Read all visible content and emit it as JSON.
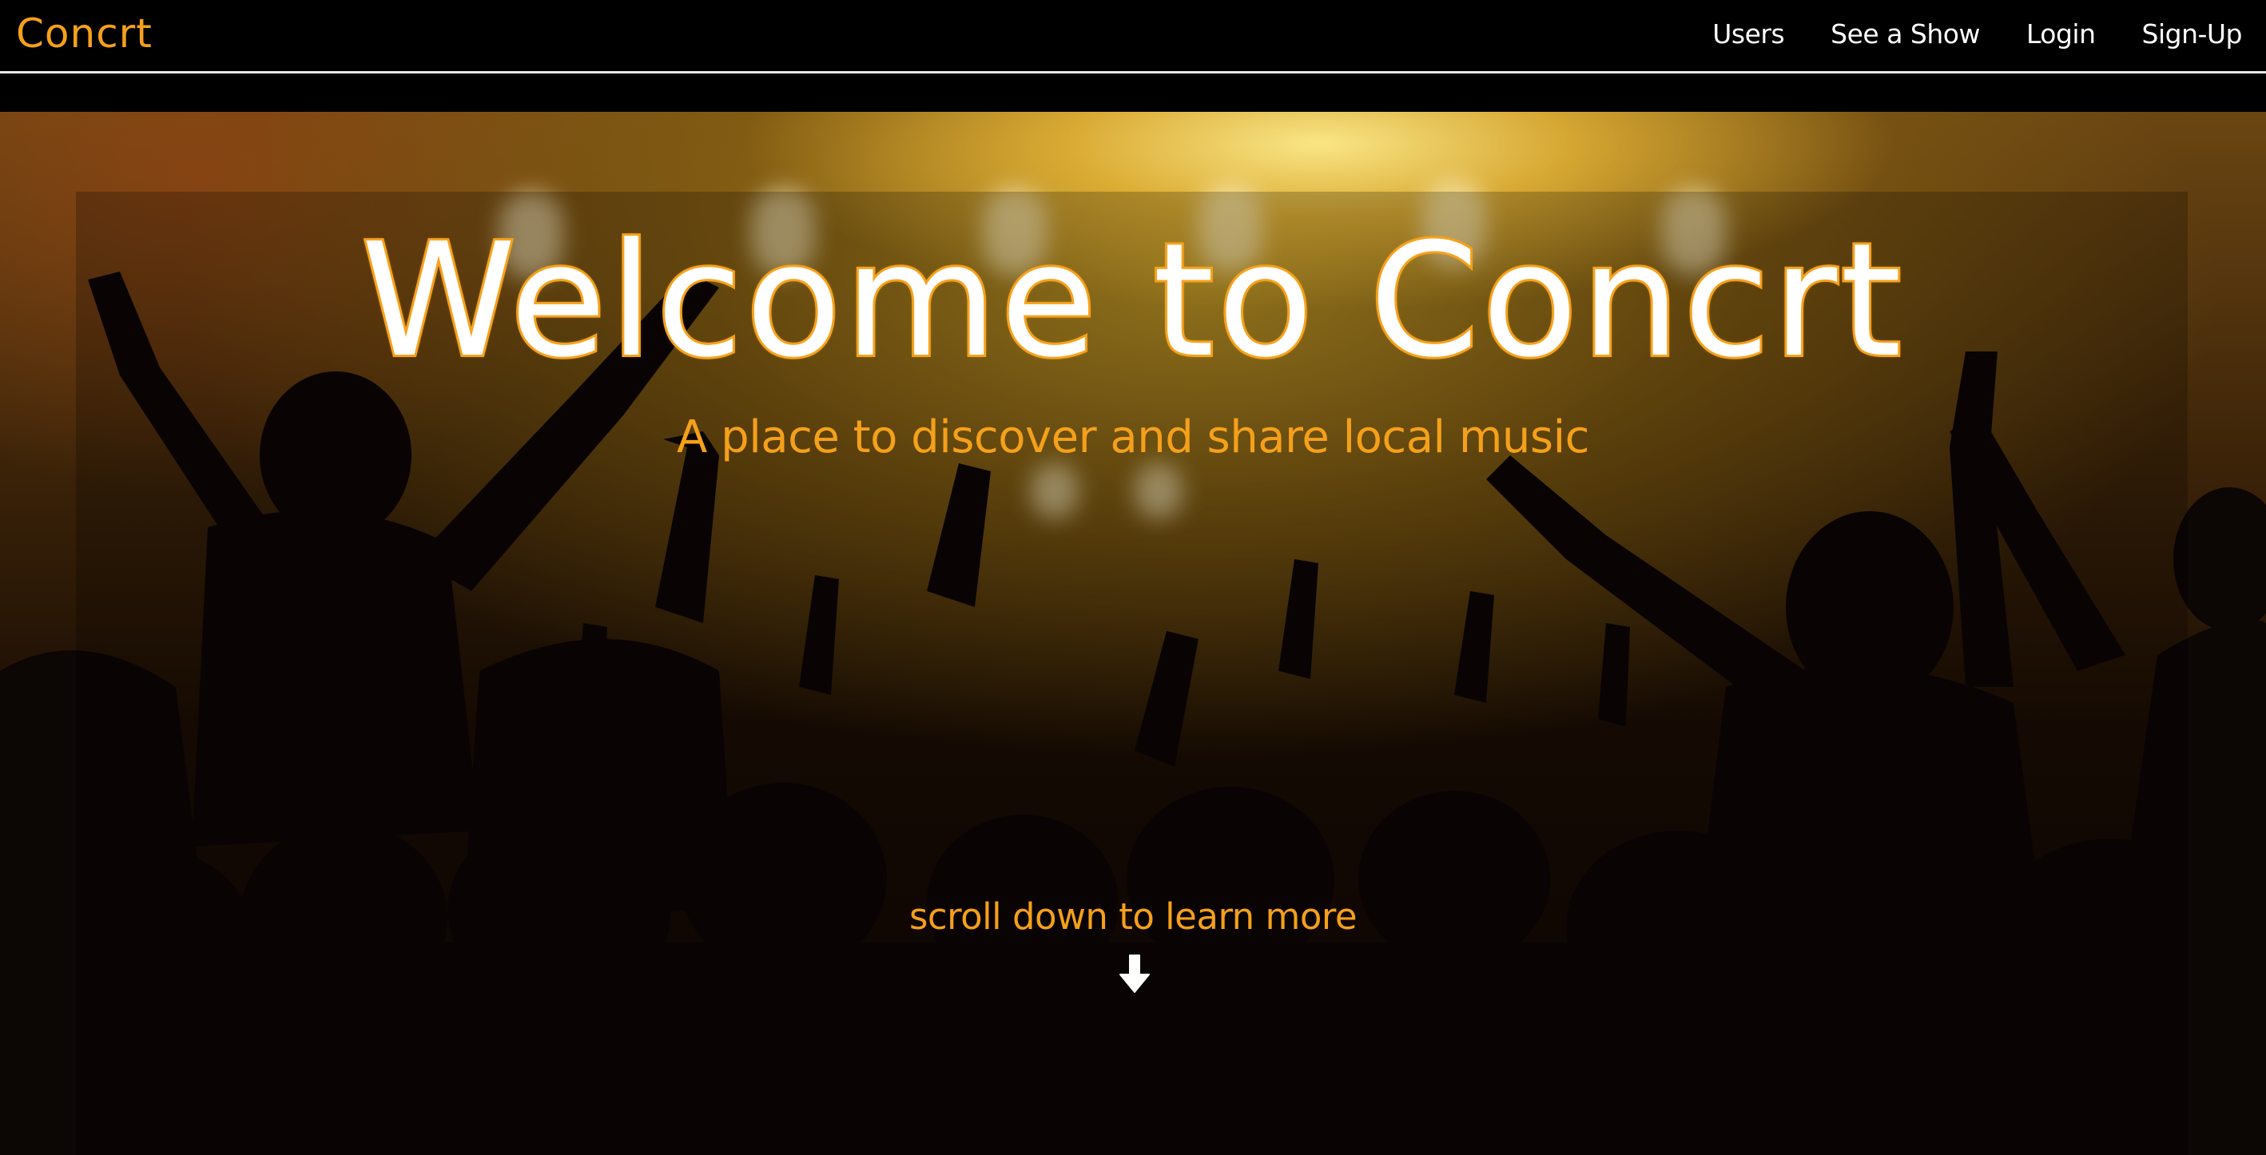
{
  "navbar": {
    "brand": "Concrt",
    "links": [
      {
        "label": "Users"
      },
      {
        "label": "See a Show"
      },
      {
        "label": "Login"
      },
      {
        "label": "Sign-Up"
      }
    ]
  },
  "hero": {
    "title": "Welcome to Concrt",
    "subtitle": "A place to discover and share local music",
    "scroll_hint": "scroll down to learn more",
    "scroll_icon": "arrow-down-icon"
  },
  "colors": {
    "accent": "#f5a01a",
    "navbar_bg": "#000000",
    "text_light": "#ffffff"
  }
}
